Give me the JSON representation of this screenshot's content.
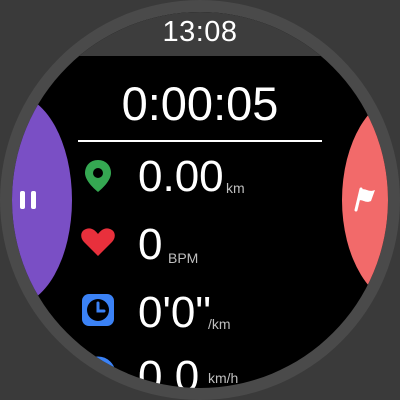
{
  "clock": {
    "time": "13:08"
  },
  "workout": {
    "duration": "0:00:05",
    "distance": {
      "value": "0.00",
      "unit": "km"
    },
    "heart_rate": {
      "value": "0",
      "unit": "BPM"
    },
    "pace": {
      "value": "0'0\"",
      "unit": "/km"
    },
    "speed": {
      "value": "0.0",
      "unit": "km/h"
    }
  },
  "controls": {
    "pause_icon": "pause-icon",
    "flag_icon": "flag-icon"
  },
  "colors": {
    "pause_button": "#7a4fc5",
    "flag_button": "#f26a6a",
    "location_icon": "#35a852",
    "heart_icon": "#e8303c",
    "clock_icon": "#3b82f6"
  }
}
